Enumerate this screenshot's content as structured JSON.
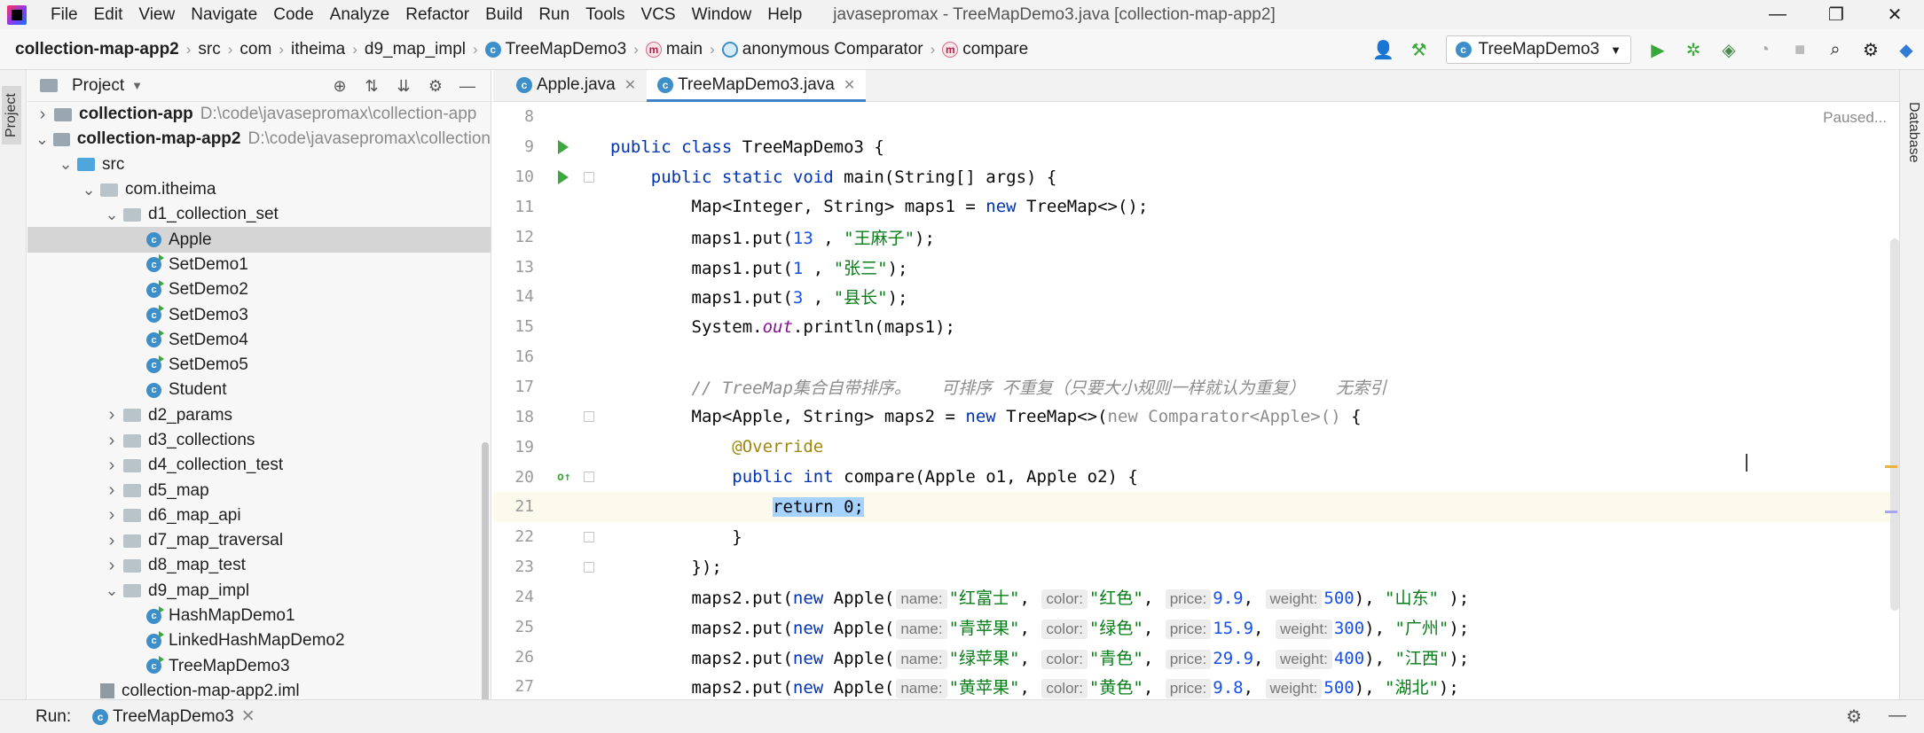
{
  "app": {
    "menu": [
      "File",
      "Edit",
      "View",
      "Navigate",
      "Code",
      "Analyze",
      "Refactor",
      "Build",
      "Run",
      "Tools",
      "VCS",
      "Window",
      "Help"
    ],
    "window_title": "javasepromax - TreeMapDemo3.java [collection-map-app2]",
    "window_controls": [
      "—",
      "❐",
      "✕"
    ]
  },
  "breadcrumbs": [
    "collection-map-app2",
    "src",
    "com",
    "itheima",
    "d9_map_impl",
    "TreeMapDemo3",
    "main",
    "anonymous Comparator",
    "compare"
  ],
  "toolbar": {
    "run_config": "TreeMapDemo3"
  },
  "left_strip": {
    "label": "Project"
  },
  "right_strip": {
    "label": "Database"
  },
  "project": {
    "title": "Project",
    "tree": [
      {
        "label": "collection-app",
        "path": "D:\\code\\javasepromax\\collection-app",
        "type": "module",
        "depth": 0,
        "expanded": false
      },
      {
        "label": "collection-map-app2",
        "path": "D:\\code\\javasepromax\\collection",
        "type": "module",
        "depth": 0,
        "expanded": true
      },
      {
        "label": "src",
        "type": "src",
        "depth": 1,
        "expanded": true
      },
      {
        "label": "com.itheima",
        "type": "package",
        "depth": 2,
        "expanded": true
      },
      {
        "label": "d1_collection_set",
        "type": "package",
        "depth": 3,
        "expanded": true
      },
      {
        "label": "Apple",
        "type": "class",
        "depth": 4,
        "selected": true
      },
      {
        "label": "SetDemo1",
        "type": "runclass",
        "depth": 4
      },
      {
        "label": "SetDemo2",
        "type": "runclass",
        "depth": 4
      },
      {
        "label": "SetDemo3",
        "type": "runclass",
        "depth": 4
      },
      {
        "label": "SetDemo4",
        "type": "runclass",
        "depth": 4
      },
      {
        "label": "SetDemo5",
        "type": "runclass",
        "depth": 4
      },
      {
        "label": "Student",
        "type": "class",
        "depth": 4
      },
      {
        "label": "d2_params",
        "type": "package",
        "depth": 3,
        "expanded": false
      },
      {
        "label": "d3_collections",
        "type": "package",
        "depth": 3,
        "expanded": false
      },
      {
        "label": "d4_collection_test",
        "type": "package",
        "depth": 3,
        "expanded": false
      },
      {
        "label": "d5_map",
        "type": "package",
        "depth": 3,
        "expanded": false
      },
      {
        "label": "d6_map_api",
        "type": "package",
        "depth": 3,
        "expanded": false
      },
      {
        "label": "d7_map_traversal",
        "type": "package",
        "depth": 3,
        "expanded": false
      },
      {
        "label": "d8_map_test",
        "type": "package",
        "depth": 3,
        "expanded": false
      },
      {
        "label": "d9_map_impl",
        "type": "package",
        "depth": 3,
        "expanded": true
      },
      {
        "label": "HashMapDemo1",
        "type": "runclass",
        "depth": 4
      },
      {
        "label": "LinkedHashMapDemo2",
        "type": "runclass",
        "depth": 4
      },
      {
        "label": "TreeMapDemo3",
        "type": "runclass",
        "depth": 4
      },
      {
        "label": "collection-map-app2.iml",
        "type": "iml",
        "depth": 2
      }
    ]
  },
  "editor": {
    "tabs": [
      {
        "label": "Apple.java",
        "active": false
      },
      {
        "label": "TreeMapDemo3.java",
        "active": true
      }
    ],
    "status": "Paused...",
    "lines": [
      {
        "n": "8",
        "tokens": []
      },
      {
        "n": "9",
        "run": true,
        "tokens": [
          [
            "kw",
            "public "
          ],
          [
            "kw",
            "class "
          ],
          [
            "t",
            "TreeMapDemo3 {"
          ]
        ]
      },
      {
        "n": "10",
        "run": true,
        "fold": true,
        "tokens": [
          [
            "t",
            "    "
          ],
          [
            "kw",
            "public static void "
          ],
          [
            "t",
            "main(String[] args) {"
          ]
        ]
      },
      {
        "n": "11",
        "tokens": [
          [
            "t",
            "        Map<Integer, String> maps1 = "
          ],
          [
            "kw",
            "new "
          ],
          [
            "t",
            "TreeMap<>();"
          ]
        ]
      },
      {
        "n": "12",
        "tokens": [
          [
            "t",
            "        maps1.put("
          ],
          [
            "num",
            "13"
          ],
          [
            "t",
            " , "
          ],
          [
            "str",
            "\"王麻子\""
          ],
          [
            "t",
            ");"
          ]
        ]
      },
      {
        "n": "13",
        "tokens": [
          [
            "t",
            "        maps1.put("
          ],
          [
            "num",
            "1"
          ],
          [
            "t",
            " , "
          ],
          [
            "str",
            "\"张三\""
          ],
          [
            "t",
            ");"
          ]
        ]
      },
      {
        "n": "14",
        "tokens": [
          [
            "t",
            "        maps1.put("
          ],
          [
            "num",
            "3"
          ],
          [
            "t",
            " , "
          ],
          [
            "str",
            "\"县长\""
          ],
          [
            "t",
            ");"
          ]
        ]
      },
      {
        "n": "15",
        "tokens": [
          [
            "t",
            "        System."
          ],
          [
            "fld",
            "out"
          ],
          [
            "t",
            ".println(maps1);"
          ]
        ]
      },
      {
        "n": "16",
        "tokens": []
      },
      {
        "n": "17",
        "tokens": [
          [
            "t",
            "        "
          ],
          [
            "cmt",
            "// TreeMap集合自带排序。   可排序 不重复（只要大小规则一样就认为重复）   无索引"
          ]
        ]
      },
      {
        "n": "18",
        "fold": true,
        "tokens": [
          [
            "t",
            "        Map<Apple, String> maps2 = "
          ],
          [
            "kw",
            "new "
          ],
          [
            "t",
            "TreeMap<>("
          ],
          [
            "grey",
            "new Comparator<Apple>() "
          ],
          [
            "t",
            "{"
          ]
        ]
      },
      {
        "n": "19",
        "tokens": [
          [
            "t",
            "            "
          ],
          [
            "ann",
            "@Override"
          ]
        ]
      },
      {
        "n": "20",
        "impl": true,
        "fold": true,
        "tokens": [
          [
            "t",
            "            "
          ],
          [
            "kw",
            "public int "
          ],
          [
            "t",
            "compare(Apple o1, Apple o2) {"
          ]
        ]
      },
      {
        "n": "21",
        "current": true,
        "tokens": [
          [
            "t",
            "                "
          ],
          [
            "sel",
            "return 0;"
          ]
        ]
      },
      {
        "n": "22",
        "fold": true,
        "tokens": [
          [
            "t",
            "            }"
          ]
        ]
      },
      {
        "n": "23",
        "fold": true,
        "tokens": [
          [
            "t",
            "        });"
          ]
        ]
      },
      {
        "n": "24",
        "tokens": [
          [
            "t",
            "        maps2.put("
          ],
          [
            "kw",
            "new "
          ],
          [
            "t",
            "Apple("
          ],
          [
            "hint",
            "name:"
          ],
          [
            "str",
            "\"红富士\""
          ],
          [
            "t",
            ", "
          ],
          [
            "hint",
            "color:"
          ],
          [
            "str",
            "\"红色\""
          ],
          [
            "t",
            ", "
          ],
          [
            "hint",
            "price:"
          ],
          [
            "num",
            "9.9"
          ],
          [
            "t",
            ", "
          ],
          [
            "hint",
            "weight:"
          ],
          [
            "num",
            "500"
          ],
          [
            "t",
            "), "
          ],
          [
            "str",
            "\"山东\" "
          ],
          [
            "t",
            ");"
          ]
        ]
      },
      {
        "n": "25",
        "tokens": [
          [
            "t",
            "        maps2.put("
          ],
          [
            "kw",
            "new "
          ],
          [
            "t",
            "Apple("
          ],
          [
            "hint",
            "name:"
          ],
          [
            "str",
            "\"青苹果\""
          ],
          [
            "t",
            ", "
          ],
          [
            "hint",
            "color:"
          ],
          [
            "str",
            "\"绿色\""
          ],
          [
            "t",
            ", "
          ],
          [
            "hint",
            "price:"
          ],
          [
            "num",
            "15.9"
          ],
          [
            "t",
            ", "
          ],
          [
            "hint",
            "weight:"
          ],
          [
            "num",
            "300"
          ],
          [
            "t",
            "), "
          ],
          [
            "str",
            "\"广州\""
          ],
          [
            "t",
            ");"
          ]
        ]
      },
      {
        "n": "26",
        "tokens": [
          [
            "t",
            "        maps2.put("
          ],
          [
            "kw",
            "new "
          ],
          [
            "t",
            "Apple("
          ],
          [
            "hint",
            "name:"
          ],
          [
            "str",
            "\"绿苹果\""
          ],
          [
            "t",
            ", "
          ],
          [
            "hint",
            "color:"
          ],
          [
            "str",
            "\"青色\""
          ],
          [
            "t",
            ", "
          ],
          [
            "hint",
            "price:"
          ],
          [
            "num",
            "29.9"
          ],
          [
            "t",
            ", "
          ],
          [
            "hint",
            "weight:"
          ],
          [
            "num",
            "400"
          ],
          [
            "t",
            "), "
          ],
          [
            "str",
            "\"江西\""
          ],
          [
            "t",
            ");"
          ]
        ]
      },
      {
        "n": "27",
        "tokens": [
          [
            "t",
            "        maps2.put("
          ],
          [
            "kw",
            "new "
          ],
          [
            "t",
            "Apple("
          ],
          [
            "hint",
            "name:"
          ],
          [
            "str",
            "\"黄苹果\""
          ],
          [
            "t",
            ", "
          ],
          [
            "hint",
            "color:"
          ],
          [
            "str",
            "\"黄色\""
          ],
          [
            "t",
            ", "
          ],
          [
            "hint",
            "price:"
          ],
          [
            "num",
            "9.8"
          ],
          [
            "t",
            ", "
          ],
          [
            "hint",
            "weight:"
          ],
          [
            "num",
            "500"
          ],
          [
            "t",
            "), "
          ],
          [
            "str",
            "\"湖北\""
          ],
          [
            "t",
            ");"
          ]
        ]
      }
    ]
  },
  "run_bar": {
    "label": "Run:",
    "tab": "TreeMapDemo3"
  }
}
